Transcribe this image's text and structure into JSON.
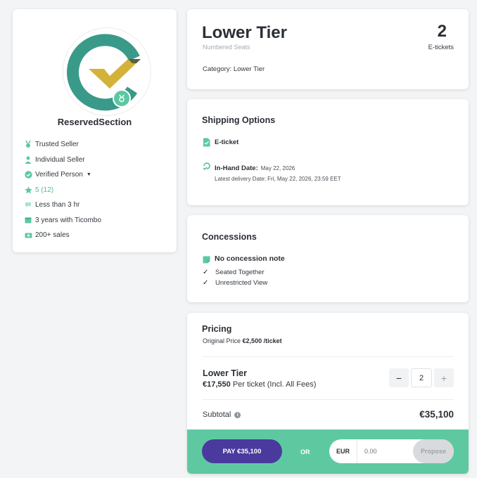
{
  "seller": {
    "name": "ReservedSection",
    "attributes": [
      {
        "icon": "medal-icon",
        "label": "Trusted Seller"
      },
      {
        "icon": "person-icon",
        "label": "Individual Seller"
      },
      {
        "icon": "verified-badge-icon",
        "label": "Verified Person"
      },
      {
        "icon": "star-icon",
        "label": "5 (12)"
      },
      {
        "icon": "chat-bubble-icon",
        "label": "Less than 3 hr"
      },
      {
        "icon": "calendar-icon",
        "label": "3 years with Ticombo"
      },
      {
        "icon": "cash-icon",
        "label": "200+ sales"
      }
    ]
  },
  "listing": {
    "title": "Lower Tier",
    "subtitle": "Numbered Seats",
    "category": "Category: Lower Tier",
    "quantity": "2",
    "quantity_label": "E-tickets"
  },
  "shipping": {
    "heading": "Shipping Options",
    "method": "E-ticket",
    "in_hand_label": "In-Hand Date:",
    "in_hand_value": "May 22, 2026",
    "latest_delivery": "Latest delivery Date: Fri, May 22, 2026, 23:59 EET"
  },
  "concessions": {
    "heading": "Concessions",
    "note": "No concession note",
    "items": [
      "Seated Together",
      "Unrestricted View"
    ]
  },
  "pricing": {
    "heading": "Pricing",
    "original_label": "Original Price",
    "original_value": "€2,500 /ticket",
    "tier_name": "Lower Tier",
    "tier_price": "€17,550",
    "tier_price_suffix": "Per ticket (Incl. All Fees)",
    "quantity": "2",
    "minus": "−",
    "plus": "+",
    "subtotal_label": "Subtotal",
    "subtotal_value": "€35,100"
  },
  "checkout": {
    "pay_label": "PAY €35,100",
    "or_label": "OR",
    "currency": "EUR",
    "offer_placeholder": "0.00",
    "propose_label": "Propose"
  },
  "colors": {
    "accent_green": "#5ec9a1",
    "pay_purple": "#4a3a9e",
    "logo_teal": "#3a9a8a",
    "logo_gold": "#d4b23a"
  }
}
